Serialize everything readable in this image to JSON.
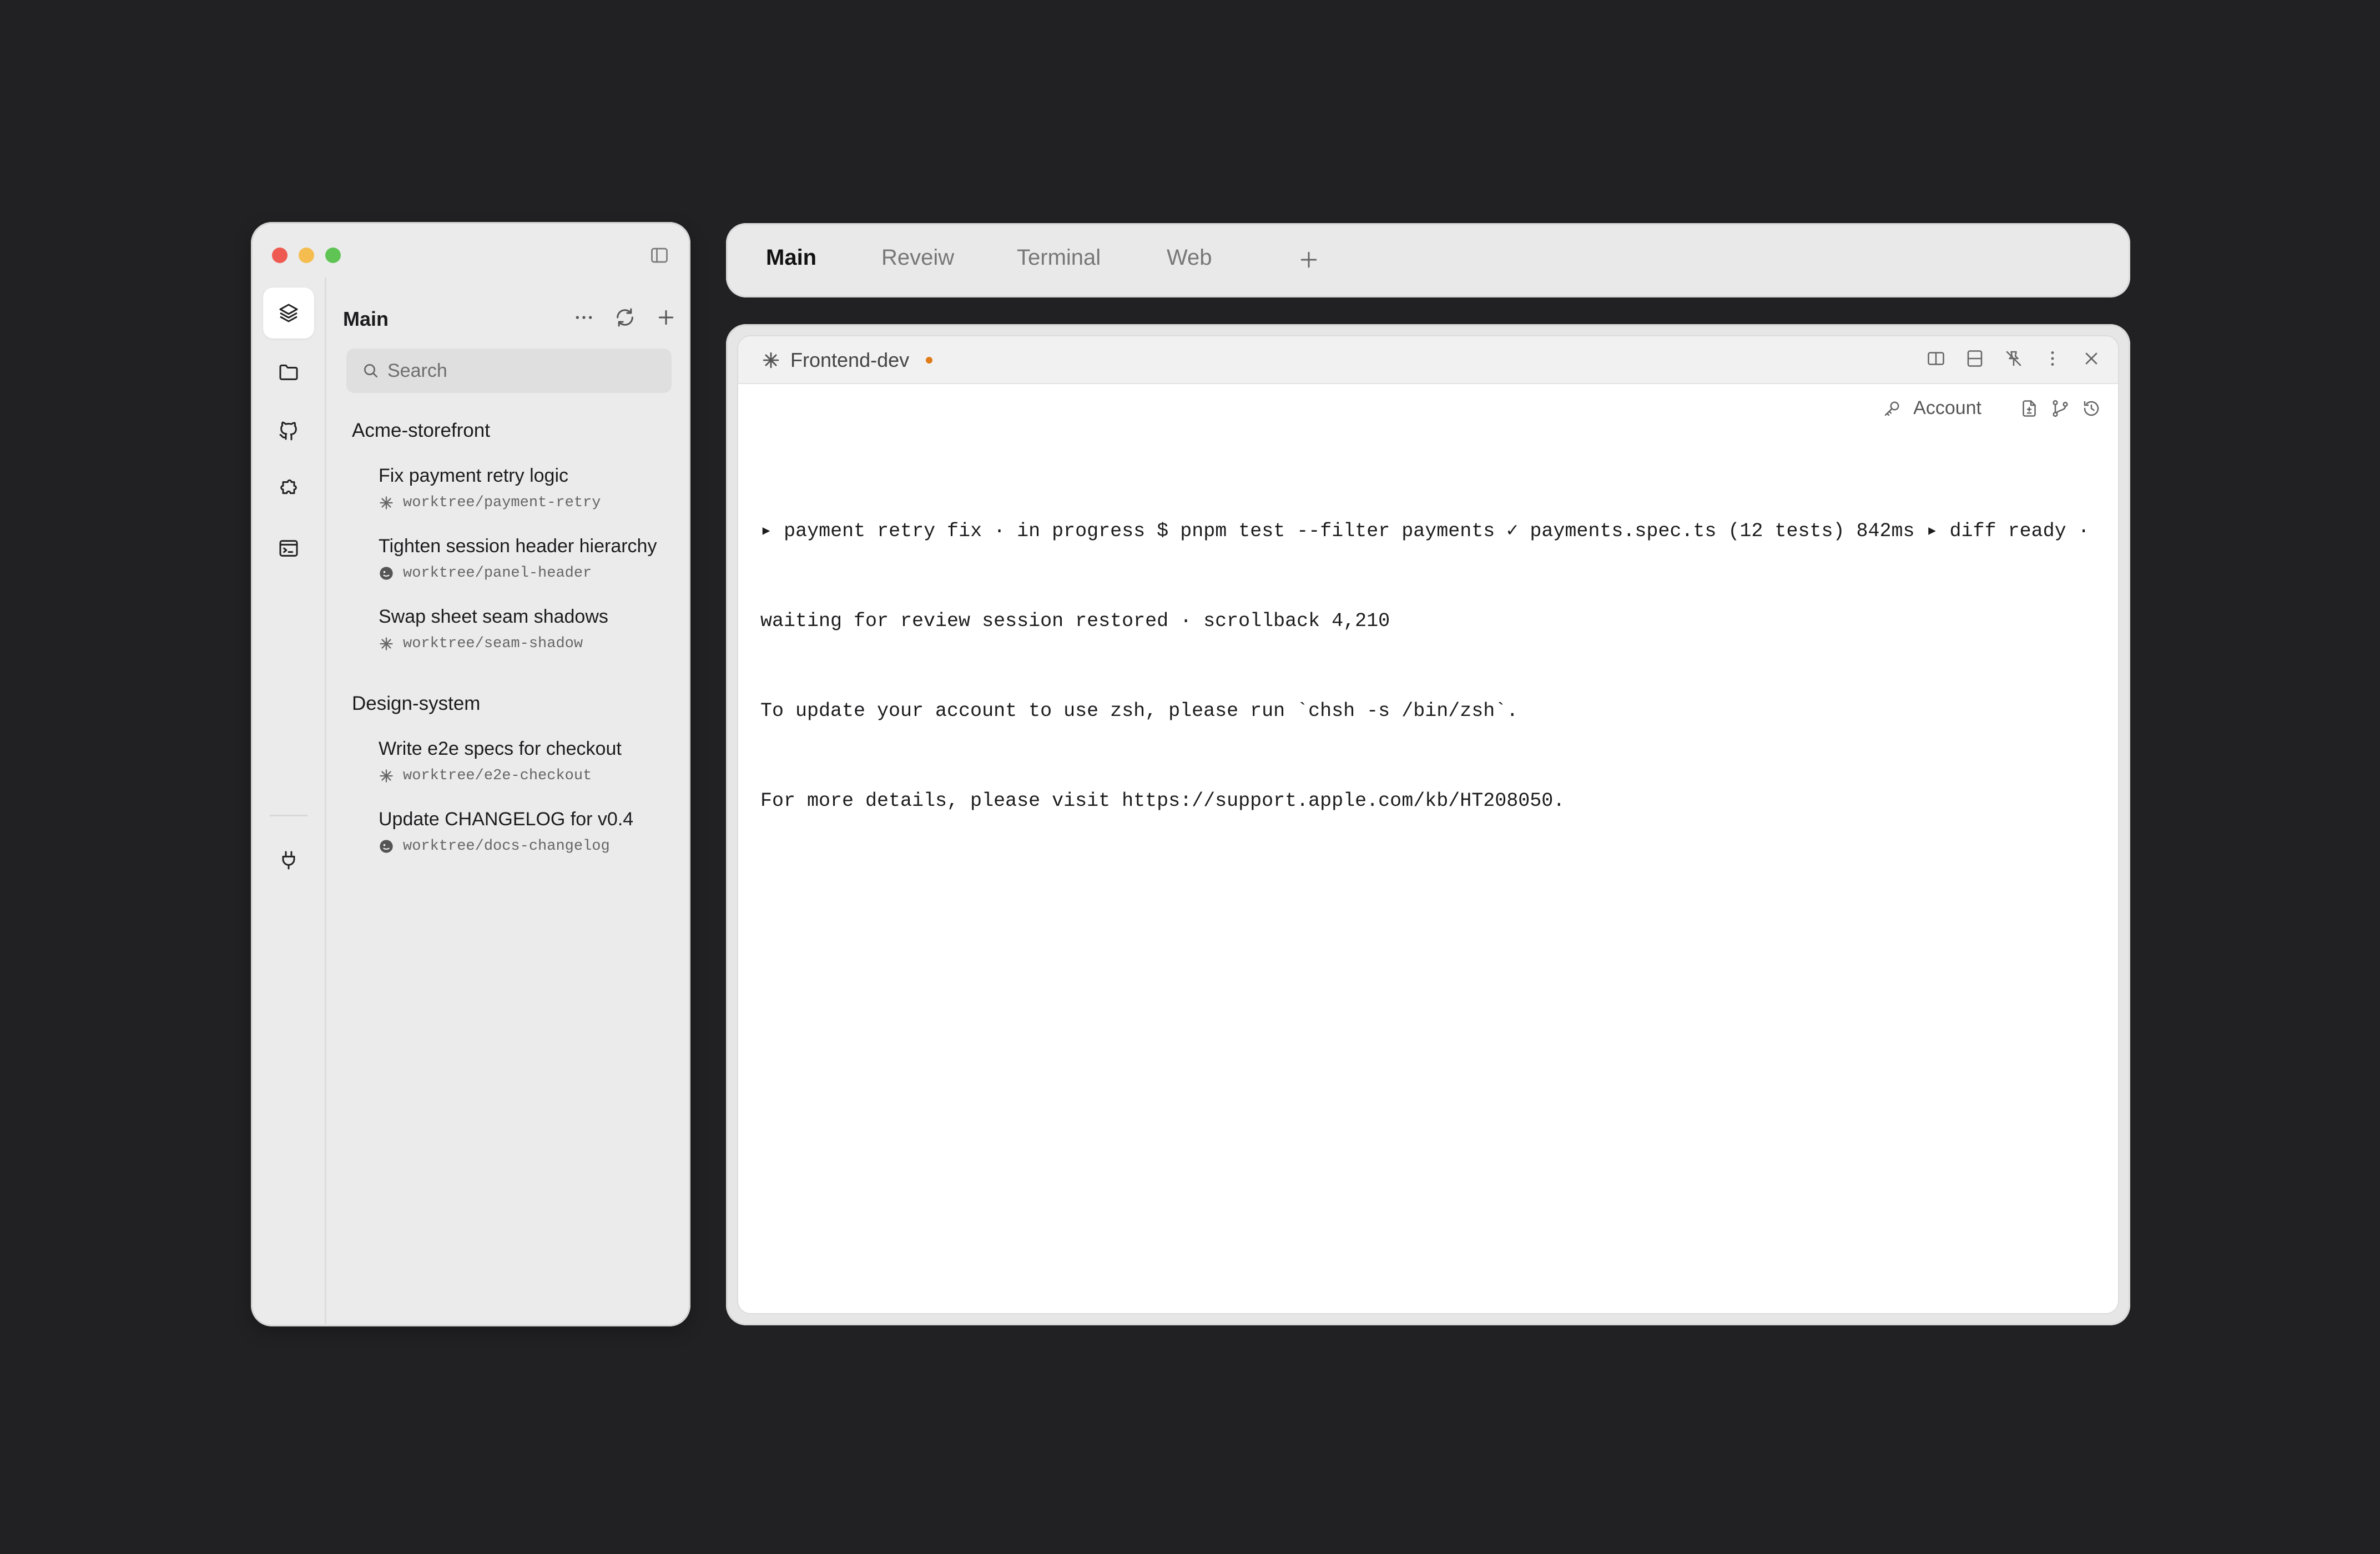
{
  "sidebar": {
    "header_title": "Main",
    "search_placeholder": "Search",
    "rail_icons": [
      "layers-icon",
      "folder-icon",
      "github-icon",
      "puzzle-icon",
      "terminal-window-icon",
      "plug-icon"
    ],
    "groups": [
      {
        "title": "Acme-storefront",
        "tasks": [
          {
            "title": "Fix payment retry logic",
            "branch": "worktree/payment-retry",
            "status_icon": "spark-icon"
          },
          {
            "title": "Tighten session header hierarchy",
            "branch": "worktree/panel-header",
            "status_icon": "agent-face-icon"
          },
          {
            "title": "Swap sheet seam shadows",
            "branch": "worktree/seam-shadow",
            "status_icon": "spark-icon"
          }
        ]
      },
      {
        "title": "Design-system",
        "tasks": [
          {
            "title": "Write e2e specs for checkout",
            "branch": "worktree/e2e-checkout",
            "status_icon": "spark-icon"
          },
          {
            "title": "Update CHANGELOG for v0.4",
            "branch": "worktree/docs-changelog",
            "status_icon": "agent-face-icon"
          }
        ]
      }
    ]
  },
  "tabs": [
    {
      "label": "Main",
      "active": true
    },
    {
      "label": "Reveiw",
      "active": false
    },
    {
      "label": "Terminal",
      "active": false
    },
    {
      "label": "Web",
      "active": false
    }
  ],
  "terminal": {
    "title": "Frontend-dev",
    "unsaved_color": "#e07b18",
    "account_label": "Account",
    "lines": [
      "▸ payment retry fix · in progress $ pnpm test --filter payments ✓ payments.spec.ts (12 tests) 842ms ▸ diff ready ·",
      "waiting for review session restored · scrollback 4,210",
      "To update your account to use zsh, please run `chsh -s /bin/zsh`.",
      "For more details, please visit https://support.apple.com/kb/HT208050."
    ]
  },
  "colors": {
    "background": "#212123",
    "traffic_red": "#ee5a52",
    "traffic_yellow": "#f5bd4f",
    "traffic_green": "#5fc454"
  }
}
